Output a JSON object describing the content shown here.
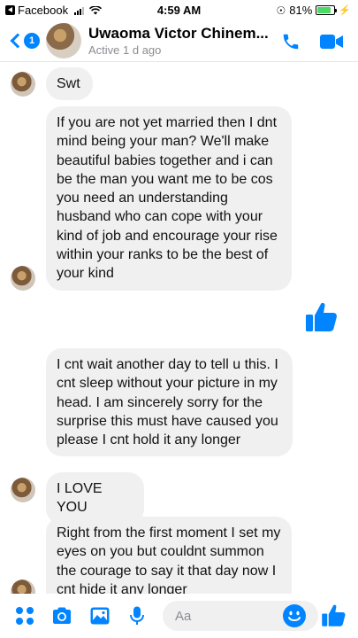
{
  "status_bar": {
    "app": "Facebook",
    "time": "4:59 AM",
    "battery": "81%",
    "battery_level": 0.81
  },
  "header": {
    "unread_count": "1",
    "contact_name": "Uwaoma Victor Chinem...",
    "contact_status": "Active 1 d ago"
  },
  "messages": [
    {
      "text": "Swt"
    },
    {
      "text": "If you are not yet married then I dnt mind being your man? We'll make beautiful babies together and i can be the man you want me to be cos you need an understanding husband who can cope with your kind of job and encourage your rise within your ranks to be the best of your kind"
    },
    {
      "text": "I cnt wait another day to tell u this. I cnt sleep without your picture in my head. I am sincerely sorry for the surprise this must have caused you please I cnt hold it any longer"
    },
    {
      "text": "I LOVE YOU"
    },
    {
      "text": "Right from the first moment I set my eyes on you but couldnt summon the courage to say it that day now I cnt hide it any longer"
    }
  ],
  "composer": {
    "placeholder": "Aa"
  },
  "colors": {
    "accent": "#0084ff",
    "bubble": "#f1f0f0",
    "muted_text": "#8a8d91",
    "battery_green": "#4cd964"
  },
  "icons": {
    "back": "chevron-left-icon",
    "call": "phone-icon",
    "video": "video-camera-icon",
    "like": "thumbs-up-icon",
    "more": "four-dots-icon",
    "camera": "camera-icon",
    "gallery": "image-icon",
    "voice": "microphone-icon",
    "emoji": "smiley-icon"
  }
}
